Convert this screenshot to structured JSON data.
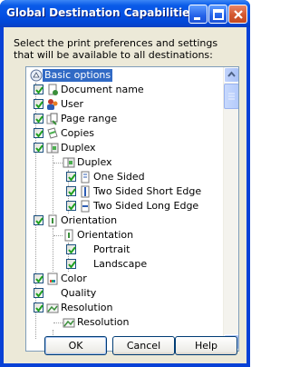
{
  "window": {
    "title": "Global Destination Capabilities"
  },
  "instructions": "Select the print preferences and settings that will be available to all destinations:",
  "tree": {
    "root": "Basic options",
    "items": [
      {
        "label": "Document name",
        "icon": "document-icon"
      },
      {
        "label": "User",
        "icon": "user-icon"
      },
      {
        "label": "Page range",
        "icon": "page-range-icon"
      },
      {
        "label": "Copies",
        "icon": "copies-icon"
      },
      {
        "label": "Duplex",
        "icon": "duplex-icon"
      },
      {
        "label": "Duplex",
        "icon": "duplex-icon"
      },
      {
        "label": "One Sided",
        "icon": "one-sided-icon"
      },
      {
        "label": "Two Sided Short Edge",
        "icon": "two-sided-short-icon"
      },
      {
        "label": "Two Sided Long Edge",
        "icon": "two-sided-long-icon"
      },
      {
        "label": "Orientation",
        "icon": "orientation-icon"
      },
      {
        "label": "Orientation",
        "icon": "orientation-icon"
      },
      {
        "label": "Portrait",
        "icon": "portrait-icon"
      },
      {
        "label": "Landscape",
        "icon": "landscape-icon"
      },
      {
        "label": "Color",
        "icon": "color-icon"
      },
      {
        "label": "Quality",
        "icon": "quality-icon"
      },
      {
        "label": "Resolution",
        "icon": "resolution-icon"
      },
      {
        "label": "Resolution",
        "icon": "resolution-icon"
      }
    ]
  },
  "buttons": {
    "ok": "OK",
    "cancel": "Cancel",
    "help": "Help"
  }
}
